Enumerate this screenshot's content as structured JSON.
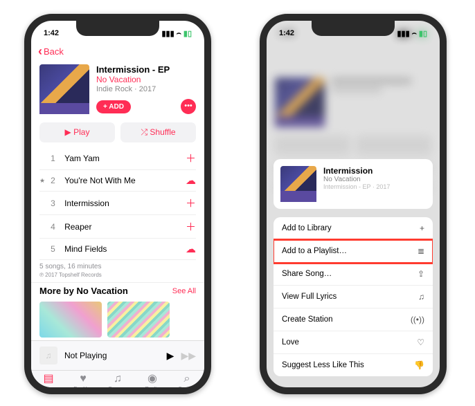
{
  "status": {
    "time": "1:42",
    "wifi": "wifi-icon",
    "signal": "signal-icon",
    "battery": "battery-icon"
  },
  "nav": {
    "back": "Back"
  },
  "album": {
    "title": "Intermission - EP",
    "artist": "No Vacation",
    "genre": "Indie Rock · 2017",
    "add_label": "+ ADD"
  },
  "buttons": {
    "play": "▶  Play",
    "shuffle": "⤮  Shuffle"
  },
  "tracks": [
    {
      "num": "1",
      "name": "Yam Yam",
      "action": "add"
    },
    {
      "num": "2",
      "name": "You're Not With Me",
      "action": "download",
      "starred": true
    },
    {
      "num": "3",
      "name": "Intermission",
      "action": "add"
    },
    {
      "num": "4",
      "name": "Reaper",
      "action": "add"
    },
    {
      "num": "5",
      "name": "Mind Fields",
      "action": "download"
    }
  ],
  "summary": "5 songs, 16 minutes",
  "copyright": "℗ 2017 Topshelf Records",
  "more": {
    "heading": "More by No Vacation",
    "seeall": "See All"
  },
  "nowplaying": {
    "title": "Not Playing"
  },
  "tabs": [
    {
      "label": "Library",
      "active": true
    },
    {
      "label": "For You",
      "active": false
    },
    {
      "label": "Browse",
      "active": false
    },
    {
      "label": "Radio",
      "active": false
    },
    {
      "label": "Search",
      "active": false
    }
  ],
  "sheet": {
    "song_title": "Intermission",
    "song_artist": "No Vacation",
    "song_album": "Intermission - EP · 2017",
    "items": [
      {
        "label": "Add to Library",
        "icon": "+"
      },
      {
        "label": "Add to a Playlist…",
        "icon": "≣",
        "highlight": true
      },
      {
        "label": "Share Song…",
        "icon": "⇪"
      },
      {
        "label": "View Full Lyrics",
        "icon": "♫"
      },
      {
        "label": "Create Station",
        "icon": "((•))"
      },
      {
        "label": "Love",
        "icon": "♡"
      },
      {
        "label": "Suggest Less Like This",
        "icon": "👎"
      }
    ]
  },
  "icons": {
    "add": "＋",
    "download": "☁",
    "play": "▶",
    "next": "▶▶",
    "dots": "•••",
    "chevron_left": "‹",
    "note": "♫",
    "signal_glyph": "▮▮▮",
    "wifi_glyph": "⌢",
    "batt_glyph": "▮▯"
  },
  "tab_icons": [
    "▤",
    "♥",
    "♫",
    "◉",
    "⌕"
  ]
}
